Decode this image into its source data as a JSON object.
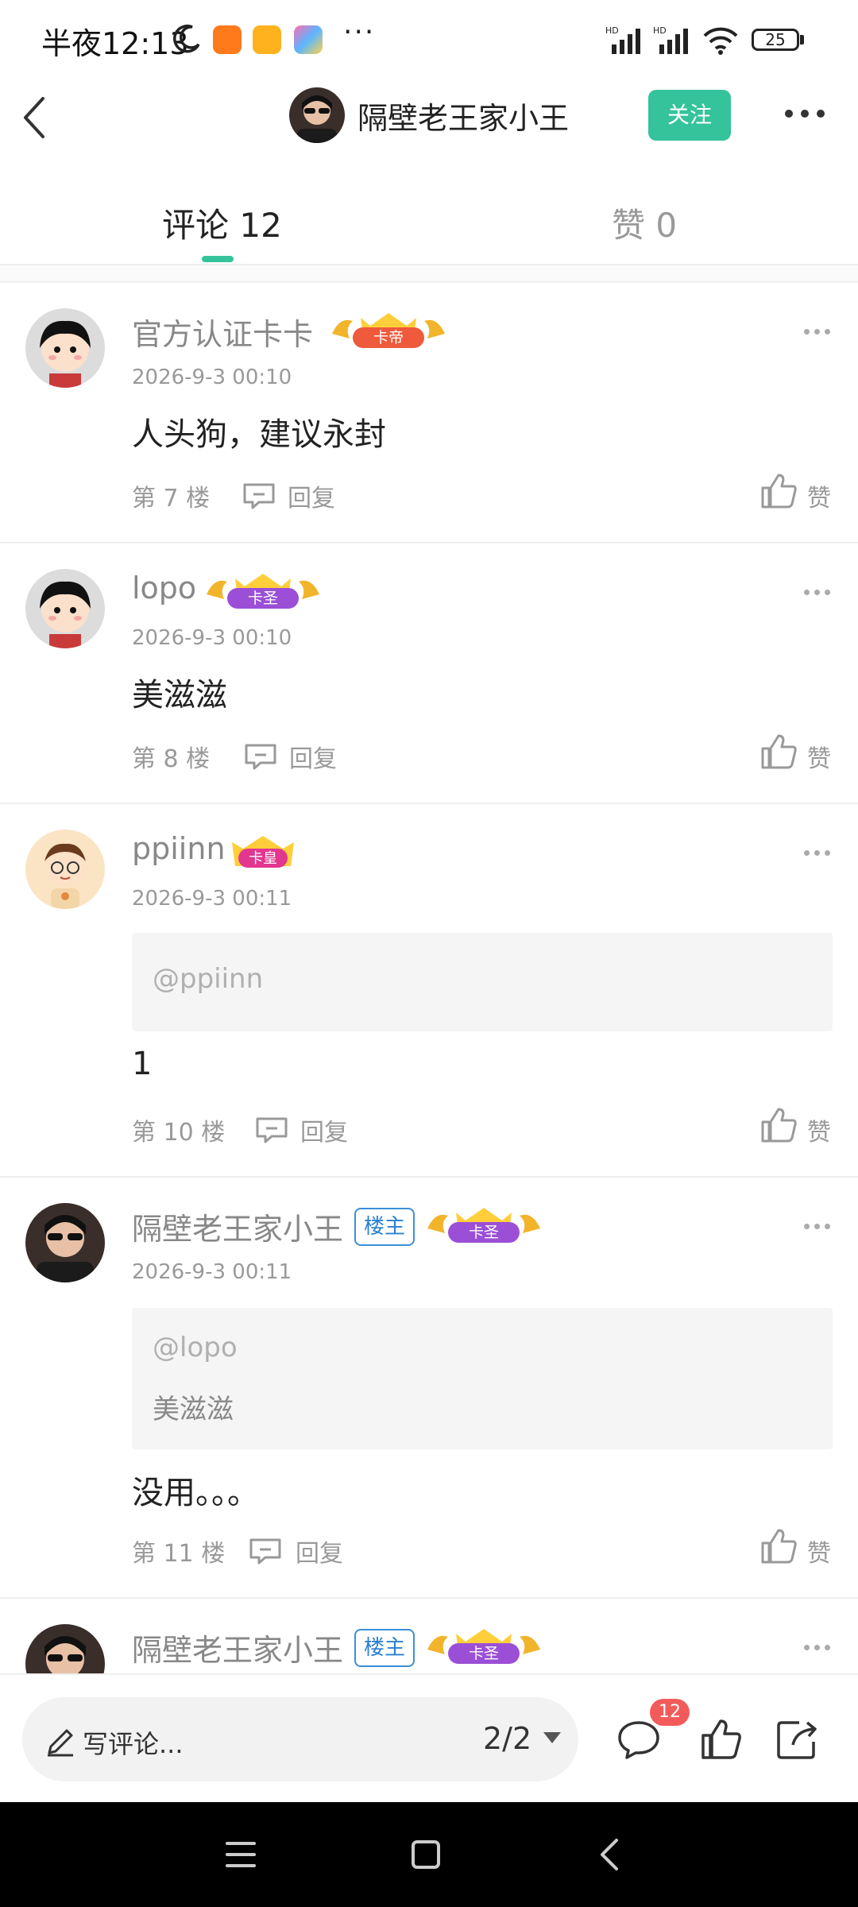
{
  "status_bar": {
    "time": "半夜12:13",
    "battery": "25",
    "signal_labels": [
      "HD",
      "HD"
    ]
  },
  "header": {
    "title": "隔壁老王家小王",
    "follow_label": "关注"
  },
  "tabs": [
    {
      "label": "评论 12",
      "active": true
    },
    {
      "label": "赞 0",
      "active": false
    }
  ],
  "comments": [
    {
      "username": "官方认证卡卡",
      "badge": "卡帝",
      "owner_tag": "",
      "time": "2026-9-3 00:10",
      "quote_mention": "",
      "quote_text": "",
      "text": "人头狗，建议永封",
      "floor": "第 7 楼",
      "reply_label": "回复",
      "like_label": "赞"
    },
    {
      "username": "lopo",
      "badge": "卡圣",
      "owner_tag": "",
      "time": "2026-9-3 00:10",
      "quote_mention": "",
      "quote_text": "",
      "text": "美滋滋",
      "floor": "第 8 楼",
      "reply_label": "回复",
      "like_label": "赞"
    },
    {
      "username": "ppiinn",
      "badge": "卡皇",
      "owner_tag": "",
      "time": "2026-9-3 00:11",
      "quote_mention": "@ppiinn",
      "quote_text": "",
      "text": "1",
      "floor": "第 10 楼",
      "reply_label": "回复",
      "like_label": "赞"
    },
    {
      "username": "隔壁老王家小王",
      "badge": "卡圣",
      "owner_tag": "楼主",
      "time": "2026-9-3 00:11",
      "quote_mention": "@lopo",
      "quote_text": "美滋滋",
      "text": "没用。。。",
      "floor": "第 11 楼",
      "reply_label": "回复",
      "like_label": "赞"
    },
    {
      "username": "隔壁老王家小王",
      "badge": "卡圣",
      "owner_tag": "楼主",
      "time": "",
      "quote_mention": "",
      "quote_text": "",
      "text": "",
      "floor": "",
      "reply_label": "",
      "like_label": ""
    }
  ],
  "bottom_bar": {
    "placeholder": "写评论...",
    "page_indicator": "2/2",
    "comment_count": "12"
  },
  "colors": {
    "accent": "#34c39a",
    "badge_red": "#f35b5b",
    "owner_blue": "#2a7fd0"
  }
}
